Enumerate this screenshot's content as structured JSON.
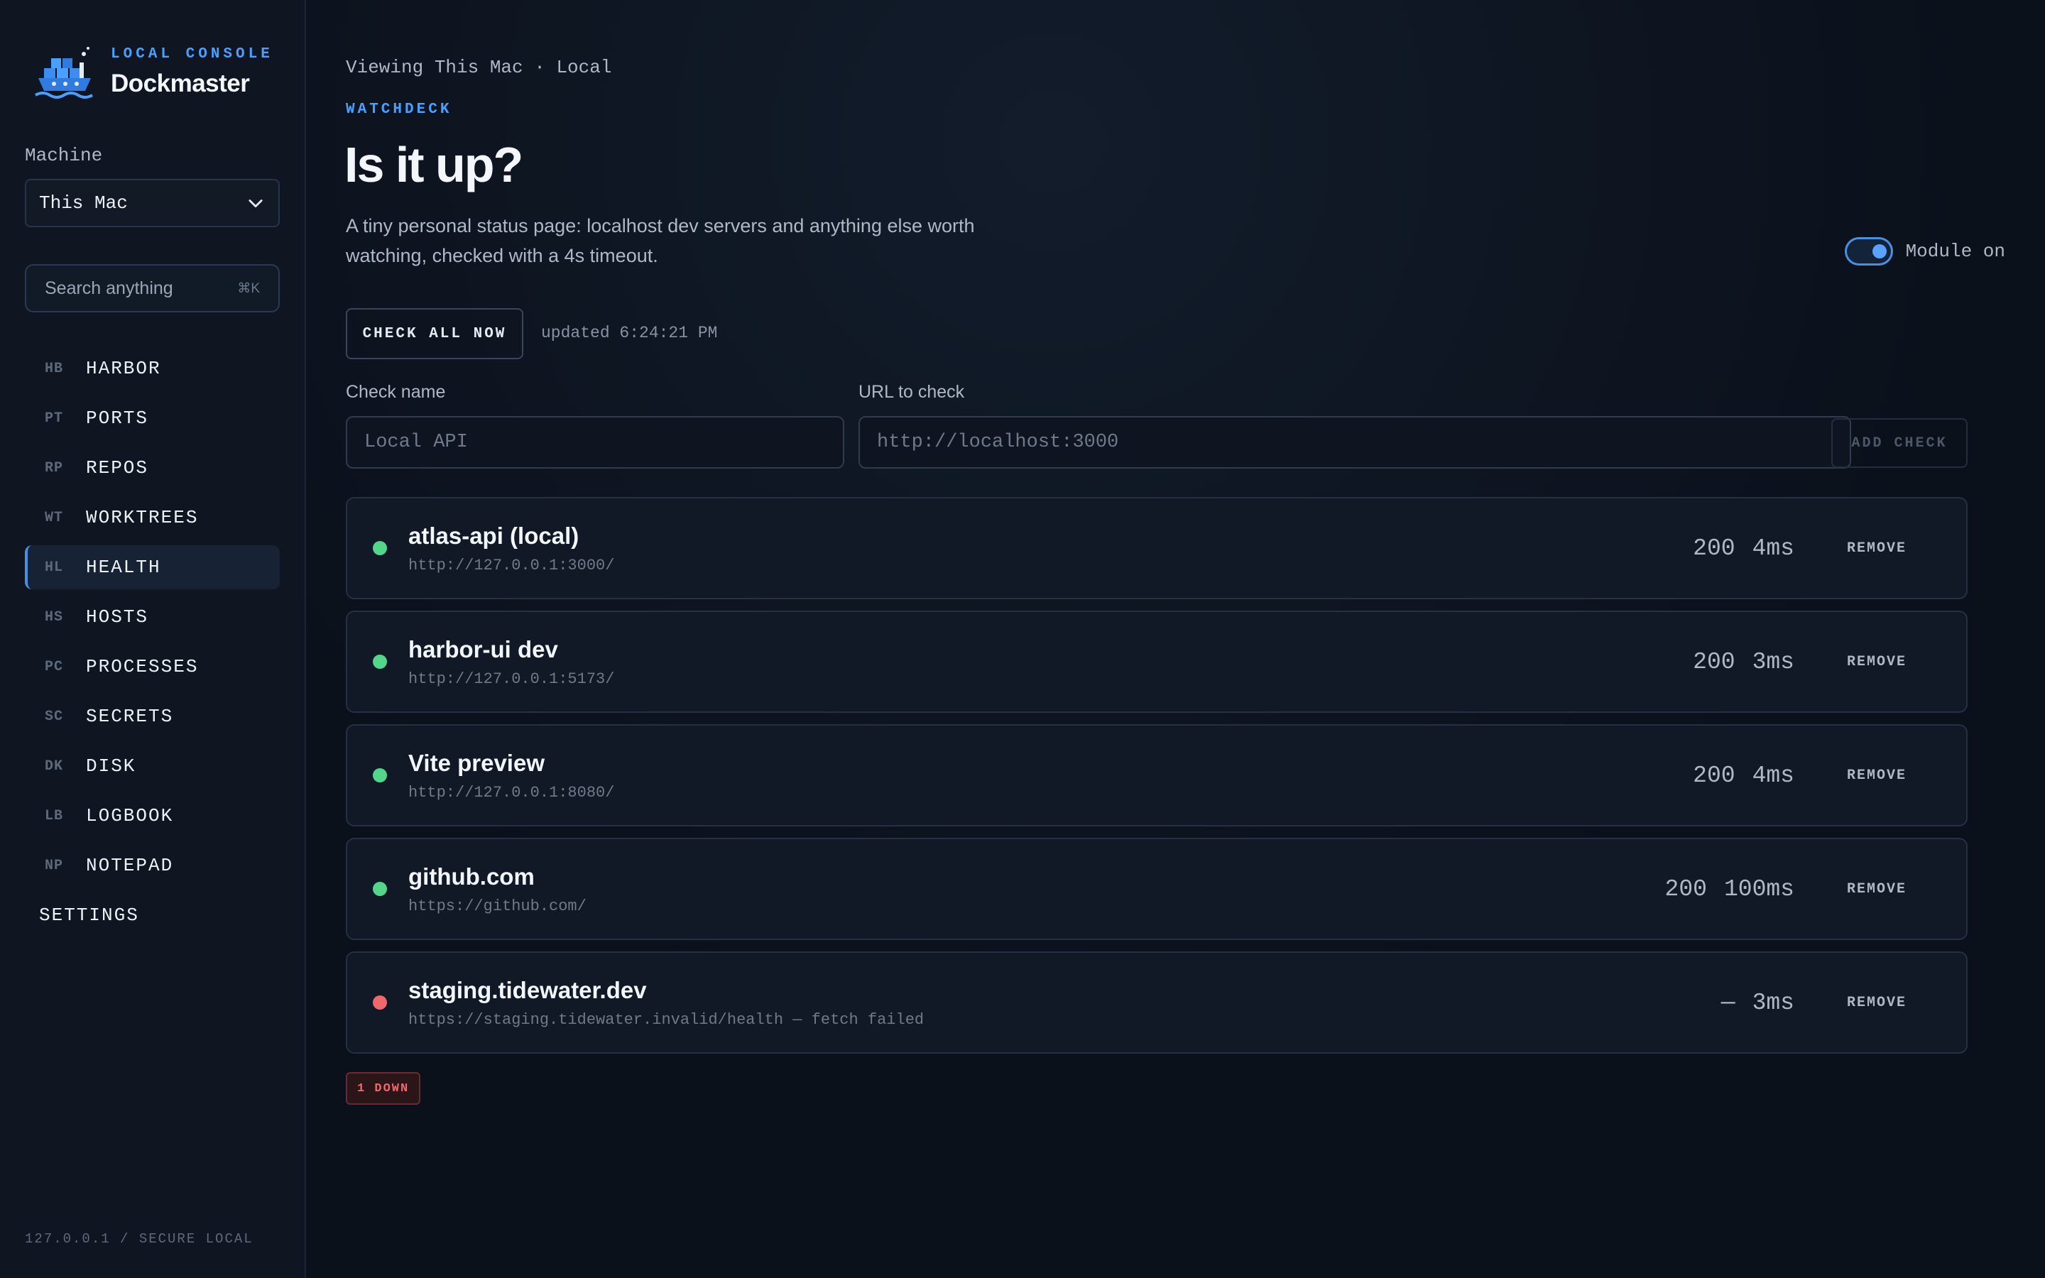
{
  "sidebar": {
    "brand_kicker": "LOCAL CONSOLE",
    "brand_title": "Dockmaster",
    "machine_label": "Machine",
    "machine_value": "This Mac",
    "search_placeholder": "Search anything",
    "search_shortcut": "⌘K",
    "items": [
      {
        "abbr": "HB",
        "label": "HARBOR"
      },
      {
        "abbr": "PT",
        "label": "PORTS"
      },
      {
        "abbr": "RP",
        "label": "REPOS"
      },
      {
        "abbr": "WT",
        "label": "WORKTREES"
      },
      {
        "abbr": "HL",
        "label": "HEALTH"
      },
      {
        "abbr": "HS",
        "label": "HOSTS"
      },
      {
        "abbr": "PC",
        "label": "PROCESSES"
      },
      {
        "abbr": "SC",
        "label": "SECRETS"
      },
      {
        "abbr": "DK",
        "label": "DISK"
      },
      {
        "abbr": "LB",
        "label": "LOGBOOK"
      },
      {
        "abbr": "NP",
        "label": "NOTEPAD"
      }
    ],
    "active_item": "HEALTH",
    "settings_label": "SETTINGS",
    "footer": "127.0.0.1 / SECURE LOCAL"
  },
  "main": {
    "breadcrumb": "Viewing This Mac · Local",
    "kicker": "WATCHDECK",
    "title": "Is it up?",
    "description": "A tiny personal status page: localhost dev servers and anything else worth watching, checked with a 4s timeout.",
    "module_toggle": {
      "label": "Module on",
      "on": true
    },
    "check_all_label": "CHECK ALL NOW",
    "updated": "updated 6:24:21 PM",
    "form": {
      "name_label": "Check name",
      "name_placeholder": "Local API",
      "url_label": "URL to check",
      "url_placeholder": "http://localhost:3000",
      "add_label": "ADD CHECK"
    },
    "checks": [
      {
        "name": "atlas-api (local)",
        "url": "http://127.0.0.1:3000/",
        "status": "200",
        "latency": "4ms",
        "up": true,
        "remove": "REMOVE"
      },
      {
        "name": "harbor-ui dev",
        "url": "http://127.0.0.1:5173/",
        "status": "200",
        "latency": "3ms",
        "up": true,
        "remove": "REMOVE"
      },
      {
        "name": "Vite preview",
        "url": "http://127.0.0.1:8080/",
        "status": "200",
        "latency": "4ms",
        "up": true,
        "remove": "REMOVE"
      },
      {
        "name": "github.com",
        "url": "https://github.com/",
        "status": "200",
        "latency": "100ms",
        "up": true,
        "remove": "REMOVE"
      },
      {
        "name": "staging.tidewater.dev",
        "url": "https://staging.tidewater.invalid/health — fetch failed",
        "status": "—",
        "latency": "3ms",
        "up": false,
        "remove": "REMOVE"
      }
    ],
    "down_badge": "1 DOWN"
  },
  "colors": {
    "accent": "#4aa0ff",
    "up": "#52d68a",
    "down": "#f0686a",
    "background": "#0b111b"
  }
}
